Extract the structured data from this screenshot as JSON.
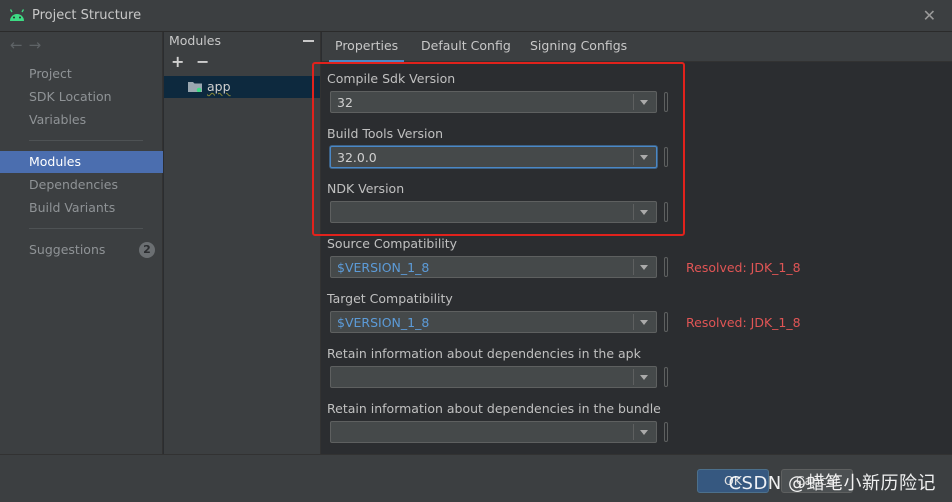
{
  "window": {
    "title": "Project Structure"
  },
  "nav": {
    "items": [
      {
        "label": "Project"
      },
      {
        "label": "SDK Location"
      },
      {
        "label": "Variables"
      },
      {
        "label": "Modules"
      },
      {
        "label": "Dependencies"
      },
      {
        "label": "Build Variants"
      },
      {
        "label": "Suggestions",
        "badge": "2"
      }
    ],
    "selected": "Modules"
  },
  "modules": {
    "header": "Modules",
    "add_label": "+",
    "remove_label": "−",
    "items": [
      {
        "name": "app"
      }
    ]
  },
  "tabs": [
    {
      "label": "Properties"
    },
    {
      "label": "Default Config"
    },
    {
      "label": "Signing Configs"
    }
  ],
  "properties": {
    "fields": [
      {
        "label": "Compile Sdk Version",
        "value": "32",
        "resolved": ""
      },
      {
        "label": "Build Tools Version",
        "value": "32.0.0",
        "resolved": ""
      },
      {
        "label": "NDK Version",
        "value": "",
        "resolved": ""
      },
      {
        "label": "Source Compatibility",
        "value": "$VERSION_1_8",
        "resolved": "Resolved: JDK_1_8"
      },
      {
        "label": "Target Compatibility",
        "value": "$VERSION_1_8",
        "resolved": "Resolved: JDK_1_8"
      },
      {
        "label": "Retain information about dependencies in the apk",
        "value": "",
        "resolved": ""
      },
      {
        "label": "Retain information about dependencies in the bundle",
        "value": "",
        "resolved": ""
      }
    ]
  },
  "footer": {
    "ok_label": "OK",
    "cancel_label": "Cancel",
    "watermark": "CSDN @蜡笔小新历险记"
  },
  "colors": {
    "accent": "#4b6eaf",
    "link_value": "#5c9bd8",
    "resolved": "#e05555",
    "highlight_box": "#e1221c"
  }
}
